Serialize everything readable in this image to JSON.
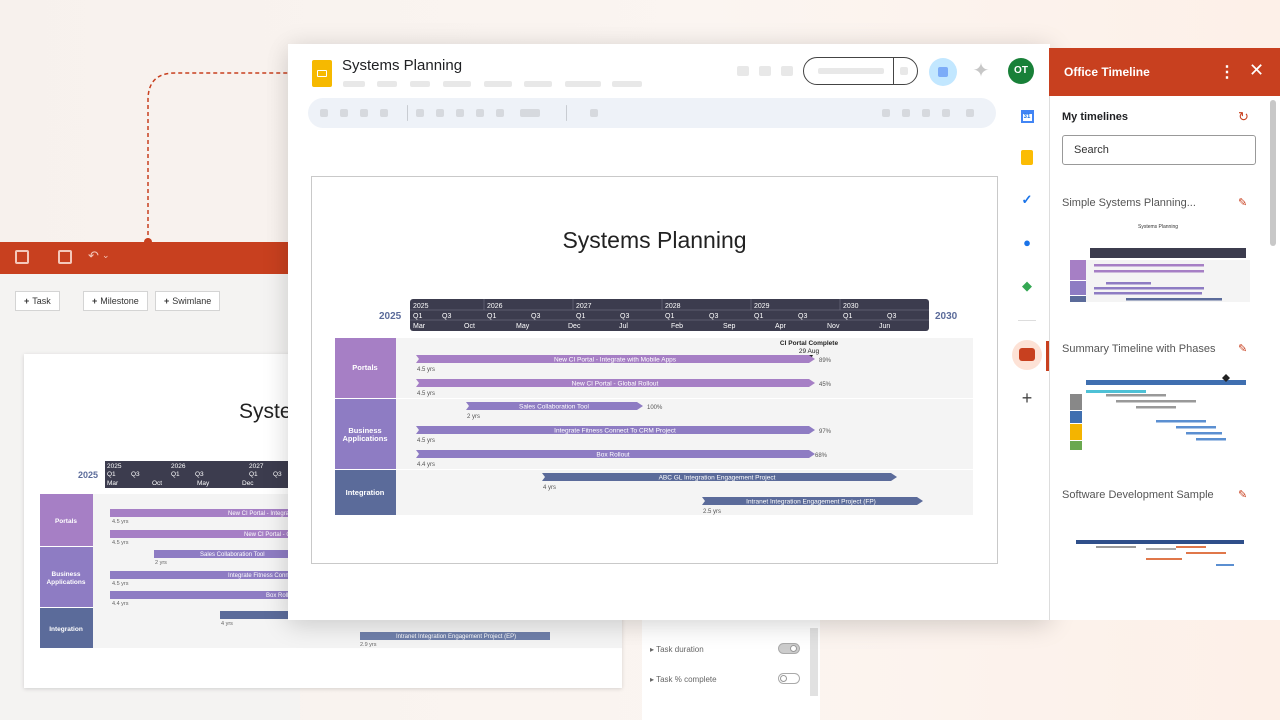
{
  "window": {
    "doc_title": "Systems Planning",
    "avatar_initials": "OT"
  },
  "colors": {
    "accent": "#c8401f",
    "portals": "#a67fc5",
    "business": "#8e7cc3",
    "integration": "#5b6b9a",
    "header_dark": "#3c3c4e"
  },
  "background_app": {
    "buttons": [
      {
        "icon": "+",
        "label": "Task"
      },
      {
        "icon": "+",
        "label": "Milestone"
      },
      {
        "icon": "+",
        "label": "Swimlane"
      }
    ],
    "slide_title": "Syste",
    "settings": [
      {
        "label": "Task duration"
      },
      {
        "label": "Task % complete"
      }
    ],
    "timeline": {
      "year_label": "2025",
      "years": [
        "2025",
        "2026",
        "2027"
      ],
      "quarters": [
        "Q1",
        "Q3",
        "Q1",
        "Q3",
        "Q1",
        "Q3"
      ],
      "months": [
        "Mar",
        "Oct",
        "May",
        "Dec"
      ],
      "swimlanes": [
        {
          "label": "Portals"
        },
        {
          "label": "Business Applications"
        },
        {
          "label": "Integration"
        }
      ],
      "tasks": [
        {
          "label": "New CI Portal - Integra",
          "duration": "4.5 yrs"
        },
        {
          "label": "New CI Portal - Glob",
          "duration": "4.5 yrs"
        },
        {
          "label": "Sales Collaboration Tool",
          "duration": "2 yrs"
        },
        {
          "label": "Integrate Fitness Conn",
          "duration": "4.5 yrs"
        },
        {
          "label": "Box Roll",
          "duration": "4.4 yrs"
        },
        {
          "label": "",
          "duration": "4 yrs"
        },
        {
          "label": "Intranet Integration Engagement Project (EP)",
          "duration": "2.9 yrs"
        }
      ]
    }
  },
  "slide": {
    "title": "Systems Planning",
    "start_year": "2025",
    "end_year": "2030",
    "years": [
      "2025",
      "2026",
      "2027",
      "2028",
      "2029",
      "2030"
    ],
    "quarters": [
      "Q1",
      "Q3",
      "Q1",
      "Q3",
      "Q1",
      "Q3",
      "Q1",
      "Q3",
      "Q1",
      "Q3",
      "Q1",
      "Q3"
    ],
    "months": [
      "Mar",
      "Oct",
      "May",
      "Dec",
      "Jul",
      "Feb",
      "Sep",
      "Apr",
      "Nov",
      "Jun"
    ],
    "milestone": {
      "label": "CI Portal Complete",
      "date": "29 Aug"
    },
    "swimlanes": [
      {
        "label": "Portals"
      },
      {
        "label": "Business Applications"
      },
      {
        "label": "Integration"
      }
    ],
    "tasks": [
      {
        "label": "New CI Portal - Integrate with Mobile Apps",
        "duration": "4.5 yrs",
        "percent": "89%"
      },
      {
        "label": "New CI Portal - Global Rollout",
        "duration": "4.5 yrs",
        "percent": "45%"
      },
      {
        "label": "Sales Collaboration Tool",
        "duration": "2 yrs",
        "percent": "100%"
      },
      {
        "label": "Integrate Fitness Connect To CRM Project",
        "duration": "4.5 yrs",
        "percent": "97%"
      },
      {
        "label": "Box Rollout",
        "duration": "4.4 yrs",
        "percent": "68%"
      },
      {
        "label": "ABC GL Integration Engagement Project",
        "duration": "4 yrs",
        "percent": ""
      },
      {
        "label": "Intranet Integration Engagement Project (FP)",
        "duration": "2.5 yrs",
        "percent": ""
      }
    ]
  },
  "side_rail": {
    "icons": [
      "calendar-icon",
      "keep-icon",
      "tasks-icon",
      "contacts-icon",
      "maps-icon",
      "office-timeline-icon",
      "add-icon"
    ]
  },
  "panel": {
    "title": "Office Timeline",
    "section_title": "My timelines",
    "search_placeholder": "Search",
    "timelines": [
      {
        "name": "Simple Systems Planning...",
        "thumb_title": "Systems Planning"
      },
      {
        "name": "Summary Timeline with Phases"
      },
      {
        "name": "Software Development Sample"
      }
    ]
  }
}
